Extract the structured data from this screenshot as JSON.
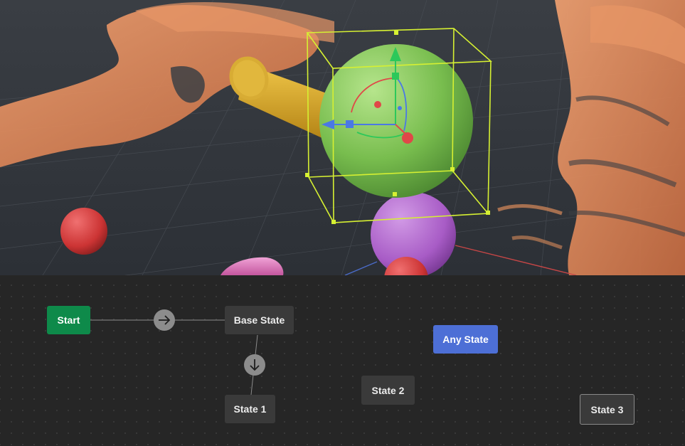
{
  "viewport": {
    "objects": [
      {
        "name": "green-sphere",
        "color": "#7cc35a",
        "selected": true
      },
      {
        "name": "purple-sphere",
        "color": "#b067d0"
      },
      {
        "name": "red-sphere",
        "color": "#d23a3a"
      },
      {
        "name": "yellow-cylinder",
        "color": "#d9a72c"
      },
      {
        "name": "pink-capsule",
        "color": "#d774b8"
      }
    ],
    "selection_color": "#d6f032",
    "gizmo_colors": {
      "x": "#e04848",
      "y": "#2cc85a",
      "z": "#4a78e6"
    }
  },
  "state_graph": {
    "nodes": {
      "start": {
        "label": "Start",
        "color": "#0e8a4a"
      },
      "base_state": {
        "label": "Base State"
      },
      "any_state": {
        "label": "Any State",
        "color": "#4d6fd6"
      },
      "state_1": {
        "label": "State 1"
      },
      "state_2": {
        "label": "State 2"
      },
      "state_3": {
        "label": "State 3",
        "selected": true
      }
    },
    "transitions": [
      {
        "from": "Start",
        "to": "Base State",
        "icon": "arrow-right-icon"
      },
      {
        "from": "Base State",
        "to": "State 1",
        "icon": "arrow-down-icon"
      }
    ]
  }
}
